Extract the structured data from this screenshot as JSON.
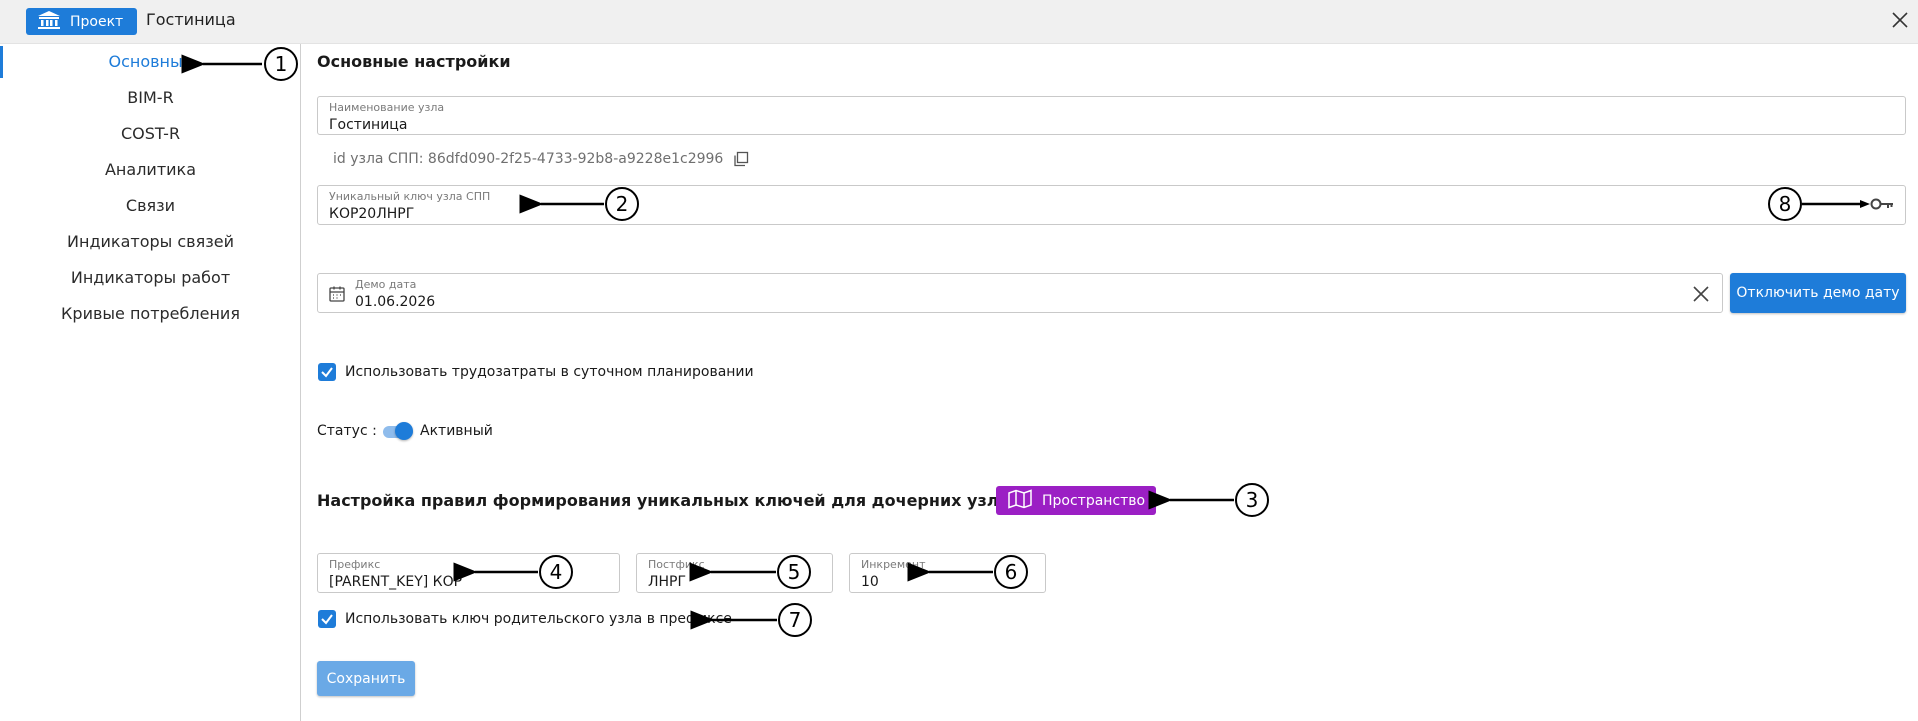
{
  "header": {
    "project_button_label": "Проект",
    "project_name": "Гостиница"
  },
  "sidebar": {
    "items": [
      {
        "label": "Основные",
        "active": true
      },
      {
        "label": "BIM-R"
      },
      {
        "label": "COST-R"
      },
      {
        "label": "Аналитика"
      },
      {
        "label": "Связи"
      },
      {
        "label": "Индикаторы связей"
      },
      {
        "label": "Индикаторы работ"
      },
      {
        "label": "Кривые потребления"
      }
    ]
  },
  "main": {
    "title": "Основные настройки",
    "node_name": {
      "label": "Наименование узла",
      "value": "Гостиница"
    },
    "spp_id_text": "id узла СПП: 86dfd090-2f25-4733-92b8-a9228e1c2996",
    "unique_key": {
      "label": "Уникальный ключ узла СПП",
      "value": "КОР20ЛНРГ"
    },
    "demo_date": {
      "label": "Демо дата",
      "value": "01.06.2026"
    },
    "disable_demo_button": "Отключить демо дату",
    "use_labor_checkbox": {
      "label": "Использовать трудозатраты в суточном планировании",
      "checked": true
    },
    "status": {
      "label": "Статус :",
      "value": "Активный",
      "on": true
    },
    "rules_title": "Настройка правил формирования уникальных ключей для дочерних узлов СПП",
    "space_button": "Пространство",
    "prefix": {
      "label": "Префикс",
      "value": "[PARENT_KEY] КОР"
    },
    "postfix": {
      "label": "Постфикс",
      "value": "ЛНРГ"
    },
    "increment": {
      "label": "Инкремент",
      "value": "10"
    },
    "use_parent_key_checkbox": {
      "label": "Использовать ключ родительского узла в префиксе",
      "checked": true
    },
    "save_button": "Сохранить"
  },
  "annotations": [
    "1",
    "2",
    "3",
    "4",
    "5",
    "6",
    "7",
    "8"
  ],
  "colors": {
    "accent": "#1e7cd9",
    "space_button": "#9b1fc4",
    "save_disabled": "#6aa9e6"
  }
}
